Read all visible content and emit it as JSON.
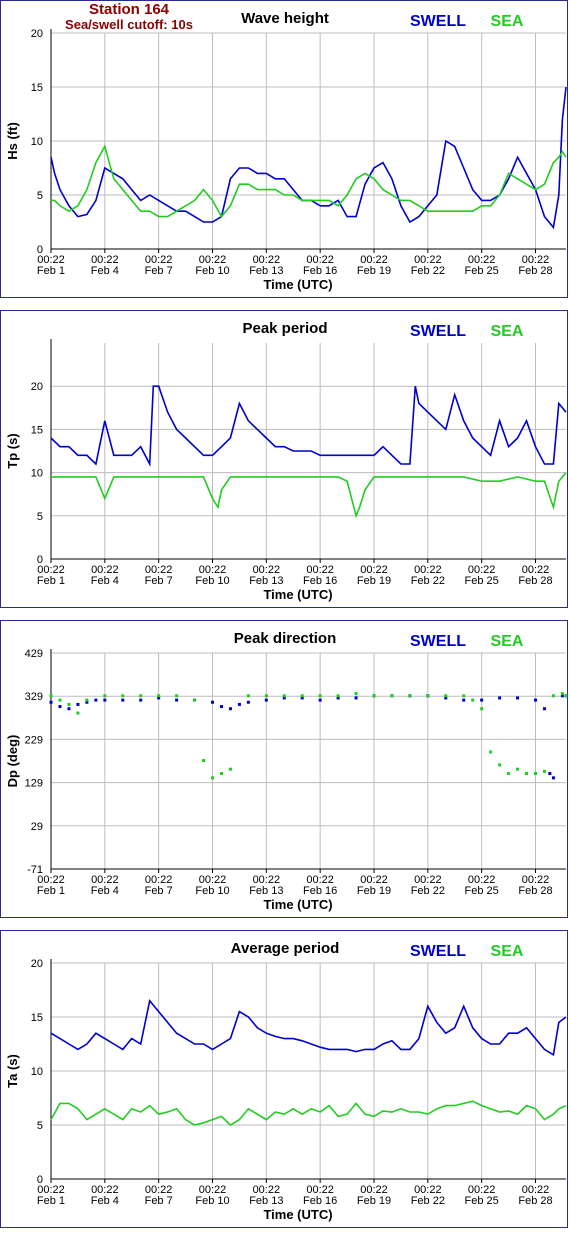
{
  "header": {
    "station": "Station 164",
    "cutoff": "Sea/swell cutoff: 10s"
  },
  "legend": {
    "swell": "SWELL",
    "sea": "SEA"
  },
  "colors": {
    "swell": "#0000cc",
    "sea": "#22cc22",
    "border": "#2a2a8a",
    "header": "#8b0000",
    "grid": "#bdbdbd"
  },
  "x_ticks": [
    {
      "time": "00:22",
      "date": "Feb 1"
    },
    {
      "time": "00:22",
      "date": "Feb 4"
    },
    {
      "time": "00:22",
      "date": "Feb 7"
    },
    {
      "time": "00:22",
      "date": "Feb 10"
    },
    {
      "time": "00:22",
      "date": "Feb 13"
    },
    {
      "time": "00:22",
      "date": "Feb 16"
    },
    {
      "time": "00:22",
      "date": "Feb 19"
    },
    {
      "time": "00:22",
      "date": "Feb 22"
    },
    {
      "time": "00:22",
      "date": "Feb 25"
    },
    {
      "time": "00:22",
      "date": "Feb 28"
    }
  ],
  "chart_data": [
    {
      "type": "line",
      "title": "Wave height",
      "xlabel": "Time (UTC)",
      "ylabel": "Hs (ft)",
      "ylim": [
        0,
        20
      ],
      "yticks": [
        "0",
        "5",
        "10",
        "15",
        "20"
      ],
      "xlim_days": [
        1,
        29.7
      ],
      "grid": true,
      "legend_position": "top-right",
      "series": [
        {
          "name": "SWELL",
          "color": "#0000cc",
          "x": [
            1,
            1.2,
            1.5,
            2,
            2.5,
            3,
            3.5,
            4,
            4.5,
            5,
            5.5,
            6,
            6.5,
            7,
            7.5,
            8,
            8.5,
            9,
            9.5,
            10,
            10.5,
            11,
            11.5,
            12,
            12.5,
            13,
            13.5,
            14,
            14.5,
            15,
            15.5,
            16,
            16.5,
            17,
            17.5,
            18,
            18.5,
            19,
            19.5,
            20,
            20.5,
            21,
            21.5,
            22,
            22.5,
            23,
            23.5,
            24,
            24.5,
            25,
            25.5,
            26,
            26.5,
            27,
            27.5,
            28,
            28.5,
            29,
            29.3,
            29.5,
            29.7
          ],
          "y": [
            8.5,
            7,
            5.5,
            4,
            3,
            3.2,
            4.5,
            7.5,
            7,
            6.5,
            5.5,
            4.5,
            5,
            4.5,
            4,
            3.5,
            3.5,
            3,
            2.5,
            2.5,
            3,
            6.5,
            7.5,
            7.5,
            7,
            7,
            6.5,
            6.5,
            5.5,
            4.5,
            4.5,
            4,
            4,
            4.5,
            3,
            3,
            6,
            7.5,
            8,
            6.5,
            4,
            2.5,
            3,
            4,
            5,
            10,
            9.5,
            7.5,
            5.5,
            4.5,
            4.5,
            5,
            6.5,
            8.5,
            7,
            5.5,
            3,
            2,
            5,
            12,
            15
          ]
        },
        {
          "name": "SEA",
          "color": "#22cc22",
          "x": [
            1,
            1.2,
            1.5,
            2,
            2.5,
            3,
            3.5,
            4,
            4.5,
            5,
            5.5,
            6,
            6.5,
            7,
            7.5,
            8,
            8.5,
            9,
            9.5,
            10,
            10.5,
            11,
            11.5,
            12,
            12.5,
            13,
            13.5,
            14,
            14.5,
            15,
            15.5,
            16,
            16.5,
            17,
            17.5,
            18,
            18.5,
            19,
            19.5,
            20,
            20.5,
            21,
            21.5,
            22,
            22.5,
            23,
            23.5,
            24,
            24.5,
            25,
            25.5,
            26,
            26.5,
            27,
            27.5,
            28,
            28.5,
            29,
            29.3,
            29.5,
            29.7
          ],
          "y": [
            4.5,
            4.5,
            4,
            3.5,
            4,
            5.5,
            8,
            9.5,
            6.5,
            5.5,
            4.5,
            3.5,
            3.5,
            3,
            3,
            3.5,
            4,
            4.5,
            5.5,
            4.5,
            3,
            4,
            6,
            6,
            5.5,
            5.5,
            5.5,
            5,
            5,
            4.5,
            4.5,
            4.5,
            4.5,
            4,
            5,
            6.5,
            7,
            6.5,
            5.5,
            5,
            4.5,
            4.5,
            4,
            3.5,
            3.5,
            3.5,
            3.5,
            3.5,
            3.5,
            4,
            4,
            5,
            7,
            6.5,
            6,
            5.5,
            6,
            8,
            8.5,
            9,
            8.5
          ]
        }
      ]
    },
    {
      "type": "line",
      "title": "Peak period",
      "xlabel": "Time (UTC)",
      "ylabel": "Tp (s)",
      "ylim": [
        0,
        25
      ],
      "yticks": [
        "0",
        "5",
        "10",
        "15",
        "20"
      ],
      "xlim_days": [
        1,
        29.7
      ],
      "grid": true,
      "legend_position": "top-right",
      "series": [
        {
          "name": "SWELL",
          "color": "#0000cc",
          "x": [
            1,
            1.5,
            2,
            2.5,
            3,
            3.5,
            4,
            4.5,
            5,
            5.5,
            6,
            6.5,
            6.7,
            7,
            7.5,
            8,
            8.5,
            9,
            9.5,
            10,
            10.5,
            11,
            11.5,
            12,
            12.5,
            13,
            13.5,
            14,
            14.5,
            15,
            15.5,
            16,
            16.5,
            17,
            17.5,
            18,
            18.5,
            19,
            19.5,
            20,
            20.5,
            21,
            21.3,
            21.5,
            22,
            22.5,
            23,
            23.5,
            24,
            24.5,
            25,
            25.5,
            26,
            26.5,
            27,
            27.5,
            28,
            28.5,
            29,
            29.3,
            29.7
          ],
          "y": [
            14,
            13,
            13,
            12,
            12,
            11,
            16,
            12,
            12,
            12,
            13,
            11,
            20,
            20,
            17,
            15,
            14,
            13,
            12,
            12,
            13,
            14,
            18,
            16,
            15,
            14,
            13,
            13,
            12.5,
            12.5,
            12.5,
            12,
            12,
            12,
            12,
            12,
            12,
            12,
            13,
            12,
            11,
            11,
            20,
            18,
            17,
            16,
            15,
            19,
            16,
            14,
            13,
            12,
            16,
            13,
            14,
            16,
            13,
            11,
            11,
            18,
            17
          ]
        },
        {
          "name": "SEA",
          "color": "#22cc22",
          "x": [
            1,
            1.5,
            2,
            2.5,
            3,
            3.5,
            4,
            4.5,
            5,
            5.5,
            6,
            6.5,
            7,
            7.5,
            8,
            8.5,
            9,
            9.5,
            10,
            10.3,
            10.5,
            11,
            11.5,
            12,
            13,
            14,
            15,
            15.5,
            16,
            16.5,
            17,
            17.5,
            18,
            18.2,
            18.5,
            19,
            20,
            21,
            22,
            23,
            24,
            25,
            26,
            27,
            28,
            28.5,
            29,
            29.3,
            29.7
          ],
          "y": [
            9.5,
            9.5,
            9.5,
            9.5,
            9.5,
            9.5,
            7,
            9.5,
            9.5,
            9.5,
            9.5,
            9.5,
            9.5,
            9.5,
            9.5,
            9.5,
            9.5,
            9.5,
            7,
            6,
            8,
            9.5,
            9.5,
            9.5,
            9.5,
            9.5,
            9.5,
            9.5,
            9.5,
            9.5,
            9.5,
            9,
            5,
            6,
            8,
            9.5,
            9.5,
            9.5,
            9.5,
            9.5,
            9.5,
            9,
            9,
            9.5,
            9,
            9,
            6,
            9,
            10
          ]
        }
      ]
    },
    {
      "type": "scatter",
      "title": "Peak direction",
      "xlabel": "Time (UTC)",
      "ylabel": "Dp (deg)",
      "ylim": [
        -71,
        429
      ],
      "yticks": [
        "-71",
        "29",
        "129",
        "229",
        "329",
        "429"
      ],
      "xlim_days": [
        1,
        29.7
      ],
      "grid": true,
      "legend_position": "top-right",
      "series": [
        {
          "name": "SWELL",
          "color": "#0000cc",
          "x": [
            1,
            1.5,
            2,
            2.5,
            3,
            3.5,
            4,
            5,
            6,
            7,
            8,
            9,
            10,
            10.5,
            11,
            11.5,
            12,
            13,
            14,
            15,
            16,
            17,
            18,
            19,
            20,
            21,
            22,
            23,
            24,
            25,
            26,
            27,
            28,
            28.5,
            28.8,
            29,
            29.5,
            29.7
          ],
          "y": [
            315,
            305,
            300,
            310,
            315,
            320,
            320,
            320,
            320,
            325,
            320,
            320,
            315,
            305,
            300,
            310,
            315,
            320,
            325,
            325,
            320,
            325,
            325,
            330,
            330,
            330,
            330,
            325,
            320,
            320,
            325,
            325,
            320,
            300,
            150,
            140,
            330,
            330
          ]
        },
        {
          "name": "SEA",
          "color": "#22cc22",
          "x": [
            1,
            1.5,
            2,
            2.5,
            3,
            4,
            5,
            6,
            7,
            8,
            9,
            9.5,
            10,
            10.5,
            11,
            12,
            13,
            14,
            15,
            16,
            17,
            18,
            19,
            20,
            21,
            22,
            23,
            24,
            24.5,
            25,
            25.5,
            26,
            26.5,
            27,
            27.5,
            28,
            28.5,
            29,
            29.5,
            29.7
          ],
          "y": [
            330,
            320,
            310,
            290,
            320,
            330,
            330,
            330,
            330,
            330,
            320,
            180,
            140,
            150,
            160,
            330,
            330,
            330,
            330,
            330,
            330,
            335,
            330,
            330,
            330,
            330,
            330,
            330,
            320,
            300,
            200,
            170,
            150,
            160,
            150,
            150,
            155,
            330,
            335,
            330
          ]
        }
      ]
    },
    {
      "type": "line",
      "title": "Average period",
      "xlabel": "Time (UTC)",
      "ylabel": "Ta (s)",
      "ylim": [
        0,
        20
      ],
      "yticks": [
        "0",
        "5",
        "10",
        "15",
        "20"
      ],
      "xlim_days": [
        1,
        29.7
      ],
      "grid": true,
      "legend_position": "top-right",
      "series": [
        {
          "name": "SWELL",
          "color": "#0000cc",
          "x": [
            1,
            1.5,
            2,
            2.5,
            3,
            3.5,
            4,
            4.5,
            5,
            5.5,
            6,
            6.5,
            7,
            7.5,
            8,
            8.5,
            9,
            9.5,
            10,
            10.5,
            11,
            11.5,
            12,
            12.5,
            13,
            13.5,
            14,
            14.5,
            15,
            15.5,
            16,
            16.5,
            17,
            17.5,
            18,
            18.5,
            19,
            19.5,
            20,
            20.5,
            21,
            21.5,
            22,
            22.5,
            23,
            23.5,
            24,
            24.5,
            25,
            25.5,
            26,
            26.5,
            27,
            27.5,
            28,
            28.5,
            29,
            29.3,
            29.7
          ],
          "y": [
            13.5,
            13,
            12.5,
            12,
            12.5,
            13.5,
            13,
            12.5,
            12,
            13,
            12.5,
            16.5,
            15.5,
            14.5,
            13.5,
            13,
            12.5,
            12.5,
            12,
            12.5,
            13,
            15.5,
            15,
            14,
            13.5,
            13.2,
            13,
            13,
            12.8,
            12.5,
            12.2,
            12,
            12,
            12,
            11.8,
            12,
            12,
            12.5,
            12.8,
            12,
            12,
            13,
            16,
            14.5,
            13.5,
            14,
            16,
            14,
            13,
            12.5,
            12.5,
            13.5,
            13.5,
            14,
            13,
            12,
            11.5,
            14.5,
            15
          ]
        },
        {
          "name": "SEA",
          "color": "#22cc22",
          "x": [
            1,
            1.5,
            2,
            2.5,
            3,
            3.5,
            4,
            4.5,
            5,
            5.5,
            6,
            6.5,
            7,
            7.5,
            8,
            8.5,
            9,
            9.5,
            10,
            10.5,
            11,
            11.5,
            12,
            12.5,
            13,
            13.5,
            14,
            14.5,
            15,
            15.5,
            16,
            16.5,
            17,
            17.5,
            18,
            18.5,
            19,
            19.5,
            20,
            20.5,
            21,
            21.5,
            22,
            22.5,
            23,
            23.5,
            24,
            24.5,
            25,
            25.5,
            26,
            26.5,
            27,
            27.5,
            28,
            28.5,
            29,
            29.3,
            29.7
          ],
          "y": [
            5.5,
            7,
            7,
            6.5,
            5.5,
            6,
            6.5,
            6,
            5.5,
            6.5,
            6.2,
            6.8,
            6,
            6.2,
            6.5,
            5.5,
            5,
            5.2,
            5.5,
            5.8,
            5,
            5.5,
            6.5,
            6,
            5.5,
            6.2,
            6,
            6.5,
            6,
            6.5,
            6.2,
            6.8,
            5.8,
            6,
            7,
            6,
            5.8,
            6.3,
            6.2,
            6.5,
            6.2,
            6.2,
            6,
            6.5,
            6.8,
            6.8,
            7,
            7.2,
            6.8,
            6.5,
            6.2,
            6.3,
            6,
            6.8,
            6.5,
            5.5,
            6,
            6.5,
            6.8
          ]
        }
      ]
    }
  ]
}
